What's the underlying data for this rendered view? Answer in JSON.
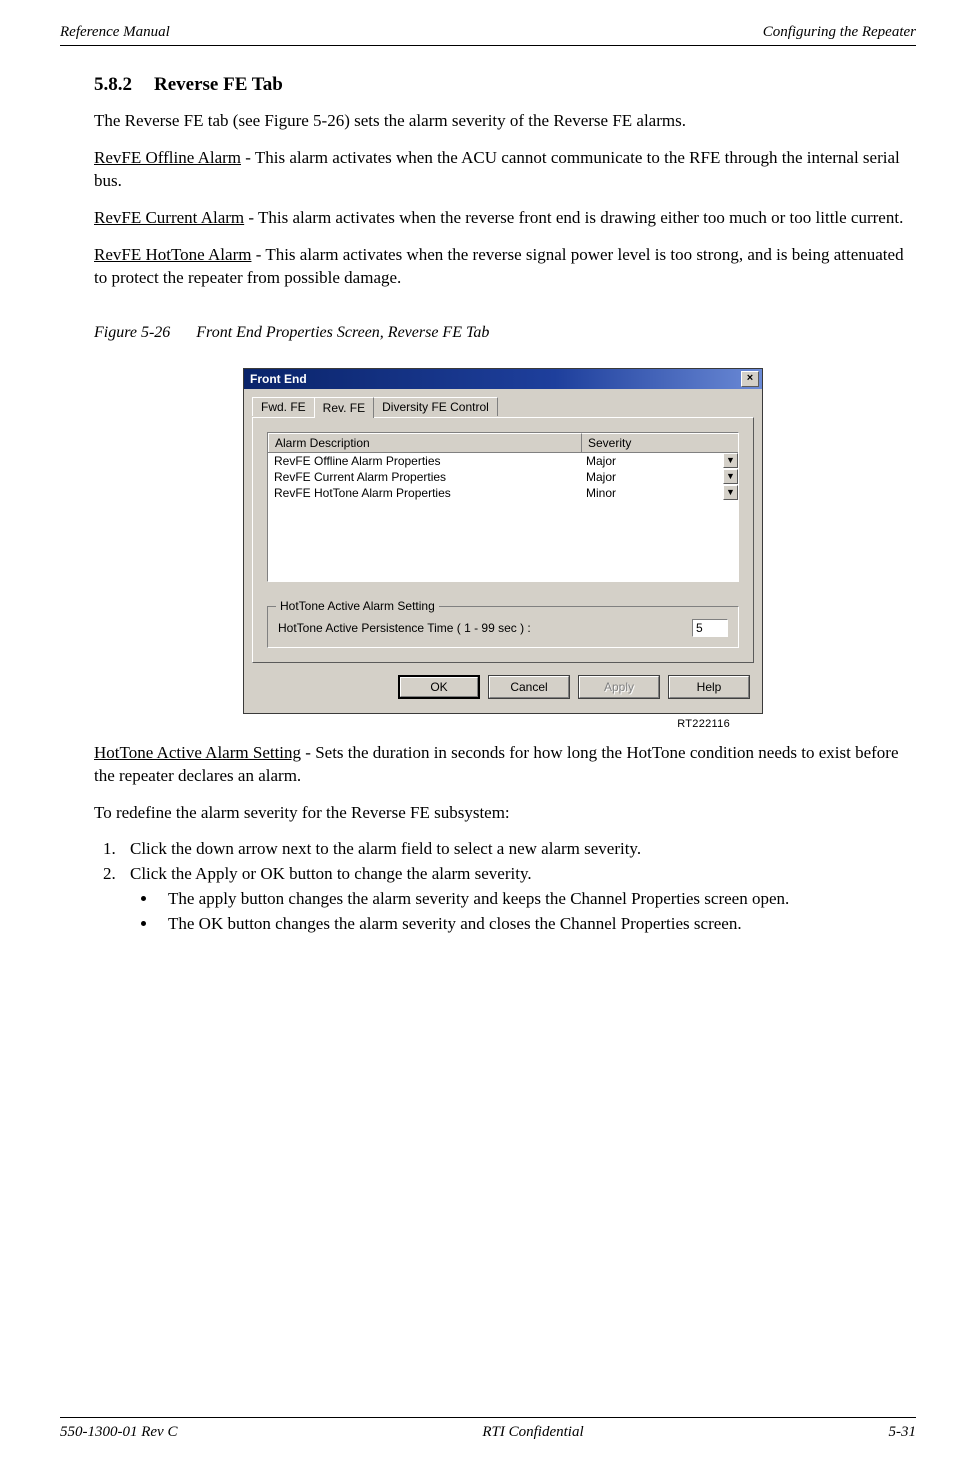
{
  "header": {
    "left": "Reference Manual",
    "right": "Configuring the Repeater"
  },
  "section": {
    "number": "5.8.2",
    "title": "Reverse FE Tab"
  },
  "para_intro": "The Reverse FE tab (see Figure 5-26) sets the alarm severity of the Reverse FE alarms.",
  "para_offline": {
    "term": "RevFE Offline Alarm",
    "text": " - This alarm activates when the ACU cannot communicate to the RFE through the internal serial bus."
  },
  "para_current": {
    "term": "RevFE Current Alarm",
    "text": " - This alarm activates when the reverse front end is drawing either too much or too little current."
  },
  "para_hottone": {
    "term": "RevFE HotTone Alarm",
    "text": " - This alarm activates when the reverse signal power level is too strong, and is being attenuated to protect the repeater from possible damage."
  },
  "figure": {
    "number": "Figure 5-26",
    "title": "Front End Properties Screen, Reverse FE Tab",
    "ref_id": "RT222116"
  },
  "dialog": {
    "title": "Front End",
    "close": "×",
    "tabs": [
      "Fwd. FE",
      "Rev. FE",
      "Diversity FE Control"
    ],
    "active_tab": 1,
    "columns": {
      "desc": "Alarm Description",
      "sev": "Severity"
    },
    "rows": [
      {
        "desc": "RevFE Offline Alarm Properties",
        "sev": "Major"
      },
      {
        "desc": "RevFE Current Alarm Properties",
        "sev": "Major"
      },
      {
        "desc": "RevFE HotTone Alarm Properties",
        "sev": "Minor"
      }
    ],
    "group": {
      "title": "HotTone Active Alarm Setting",
      "label": "HotTone Active Persistence Time  ( 1 - 99 sec ) :",
      "value": "5"
    },
    "buttons": {
      "ok": "OK",
      "cancel": "Cancel",
      "apply": "Apply",
      "help": "Help"
    }
  },
  "para_setting": {
    "term": "HotTone Active Alarm Setting",
    "text": " - Sets the duration in seconds for how long the HotTone condition needs to exist before the repeater declares an alarm."
  },
  "para_redefine": "To redefine the alarm severity for the Reverse FE subsystem:",
  "steps": [
    "Click the down arrow next to the alarm field to select a new alarm severity.",
    "Click the Apply or OK button to change the alarm severity."
  ],
  "bullets": [
    "The apply button changes the alarm severity and keeps the Channel Properties screen open.",
    "The OK button changes the alarm severity and closes the Channel Properties screen."
  ],
  "footer": {
    "left": "550-1300-01 Rev C",
    "center": "RTI Confidential",
    "right": "5-31"
  }
}
